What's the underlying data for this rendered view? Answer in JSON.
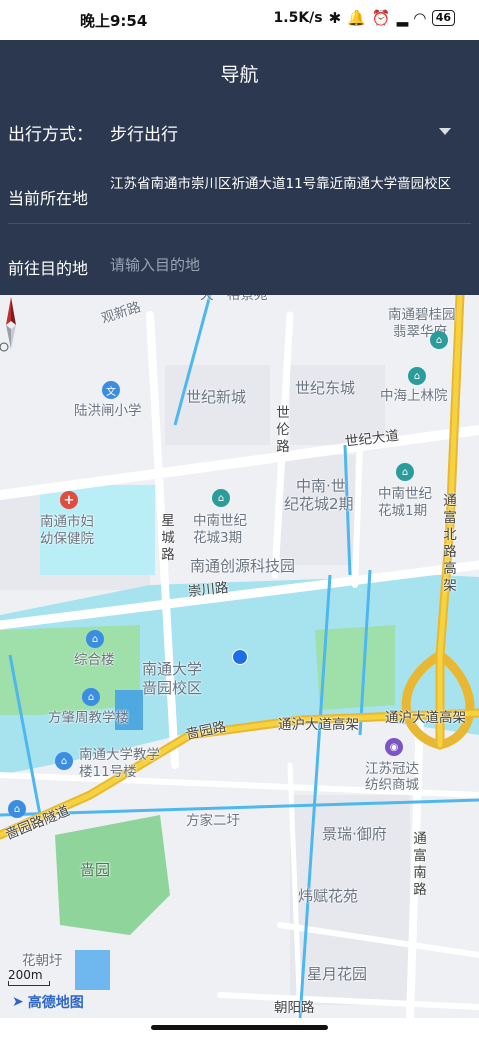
{
  "status_bar": {
    "time": "晚上9:54",
    "network_speed": "1.5K/s",
    "battery": "46",
    "icons": [
      "bluetooth-icon",
      "mute-icon",
      "alarm-icon",
      "signal-icon",
      "hd-icon",
      "wifi-icon",
      "battery-icon"
    ]
  },
  "header": {
    "title": "导航",
    "travel_mode_label": "出行方式：",
    "travel_mode_value": "步行出行",
    "current_location_label": "当前所在地",
    "current_location_value": "江苏省南通市崇川区祈通大道11号靠近南通大学啬园校区",
    "destination_label": "前往目的地",
    "destination_placeholder": "请输入目的地",
    "destination_value": ""
  },
  "map": {
    "labels": {
      "guanxin_road": "观新路",
      "tianyi_garden": "天一裕景苑",
      "nantong_bigui": "南通碧桂园",
      "feicuihuating": "翡翠华府",
      "lu_hongzha": "陆洪闸小学",
      "shiji_xincheng": "世纪新城",
      "shiji_dongcheng": "世纪东城",
      "shilun_road": "世伦路",
      "zhonghai": "中海上林院",
      "shiji_avenue": "世纪大道",
      "maternity_1": "南通市妇",
      "maternity_2": "幼保健院",
      "zhongnan_3a": "中南世纪",
      "zhongnan_3b": "花城3期",
      "zhongnan_2a": "中南·世",
      "zhongnan_2b": "纪花城2期",
      "zhongnan_1a": "中南世纪",
      "zhongnan_1b": "花城1期",
      "tongfu_elevated": "通富北路高架",
      "xingcheng_road": "星城路",
      "chuangyuan": "南通创源科技园",
      "chongchuan_road": "崇川路",
      "zonghelou": "综合楼",
      "ntu_campus_1": "南通大学",
      "ntu_campus_2": "啬园校区",
      "fangzhaozhou": "方肇周教学楼",
      "seyuan_road": "啬园路",
      "tonghu_elevated": "通沪大道高架",
      "tonghu_elevated_2": "通沪大道高架",
      "ntu_building_1": "南通大学教学",
      "ntu_building_2": "楼11号楼",
      "jiangsu_guanda_1": "江苏冠达",
      "jiangsu_guanda_2": "纺织商城",
      "seyuan_tunnel": "啬园路隧道",
      "fangjia": "方家二圩",
      "jingrui": "景瑞·御府",
      "tongfu_south": "通富南路",
      "seyuan": "啬园",
      "weifu": "炜赋花苑",
      "huachao": "花朝圩",
      "xingyue": "星月花园",
      "chaoyang_road": "朝阳路"
    },
    "poi_icons": {
      "school": "文",
      "hospital": "+",
      "building": "⌂",
      "mall": "◉"
    },
    "scale": "200m",
    "brand": "高德地图",
    "colors": {
      "water": "#a6e3ef",
      "green": "#9fdfa9",
      "road": "#ffffff",
      "elevated": "#f6d23f",
      "background": "#eef0f4"
    }
  }
}
